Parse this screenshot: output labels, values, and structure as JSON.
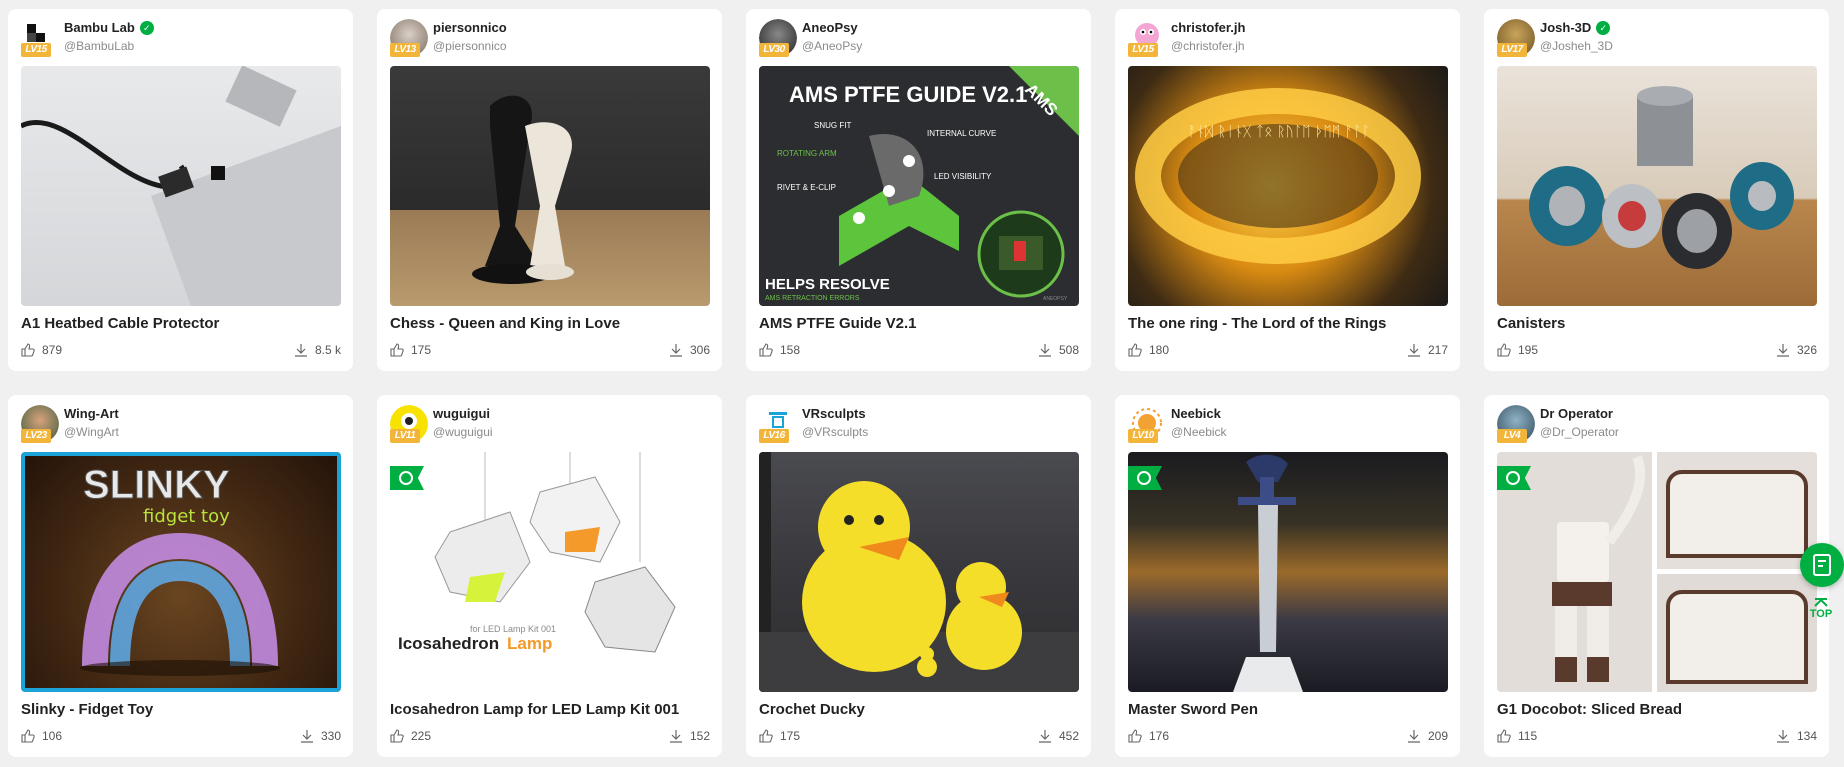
{
  "cards": [
    {
      "user": "Bambu Lab",
      "verified": true,
      "handle": "@BambuLab",
      "level": "LV15",
      "title": "A1 Heatbed Cable Protector",
      "likes": "879",
      "downloads": "8.5 k",
      "badge": false
    },
    {
      "user": "piersonnico",
      "verified": false,
      "handle": "@piersonnico",
      "level": "LV13",
      "title": "Chess - Queen and King in Love",
      "likes": "175",
      "downloads": "306",
      "badge": false
    },
    {
      "user": "AneoPsy",
      "verified": false,
      "handle": "@AneoPsy",
      "level": "LV30",
      "title": "AMS PTFE Guide V2.1",
      "likes": "158",
      "downloads": "508",
      "badge": false
    },
    {
      "user": "christofer.jh",
      "verified": false,
      "handle": "@christofer.jh",
      "level": "LV15",
      "title": "The one ring - The Lord of the Rings",
      "likes": "180",
      "downloads": "217",
      "badge": false
    },
    {
      "user": "Josh-3D",
      "verified": true,
      "handle": "@Josheh_3D",
      "level": "LV17",
      "title": "Canisters",
      "likes": "195",
      "downloads": "326",
      "badge": false
    },
    {
      "user": "Wing-Art",
      "verified": false,
      "handle": "@WingArt",
      "level": "LV23",
      "title": "Slinky - Fidget Toy",
      "likes": "106",
      "downloads": "330",
      "badge": false
    },
    {
      "user": "wuguigui",
      "verified": false,
      "handle": "@wuguigui",
      "level": "LV11",
      "title": "Icosahedron Lamp for LED Lamp Kit 001",
      "likes": "225",
      "downloads": "152",
      "badge": true
    },
    {
      "user": "VRsculpts",
      "verified": false,
      "handle": "@VRsculpts",
      "level": "LV16",
      "title": "Crochet Ducky",
      "likes": "175",
      "downloads": "452",
      "badge": false
    },
    {
      "user": "Neebick",
      "verified": false,
      "handle": "@Neebick",
      "level": "LV10",
      "title": "Master Sword Pen",
      "likes": "176",
      "downloads": "209",
      "badge": true
    },
    {
      "user": "Dr Operator",
      "verified": false,
      "handle": "@Dr_Operator",
      "level": "LV4",
      "title": "G1 Docobot: Sliced Bread",
      "likes": "115",
      "downloads": "134",
      "badge": true
    }
  ],
  "thumb_text": {
    "ams_title": "AMS PTFE GUIDE V2.1",
    "ams_corner": "AMS",
    "ams_labels": [
      "SNUG FIT",
      "INTERNAL CURVE",
      "ROTATING ARM",
      "LED VISIBILITY",
      "RIVET & E-CLIP"
    ],
    "ams_footer": "HELPS RESOLVE",
    "ams_footer_sub": "AMS RETRACTION ERRORS",
    "ams_credit": "ANEOPSY",
    "slinky_title": "SLINKY",
    "slinky_sub": "fidget toy",
    "lamp_caption_small": "for LED Lamp Kit 001",
    "lamp_caption_a": "Icosahedron",
    "lamp_caption_b": "Lamp",
    "ring_text": "ᚨᚾᛞ ᚱᛁᚾᚷ ᛏᛟ ᚱᚢᛚᛖ ᚦᛖᛗ ᚨᛚᛚ"
  },
  "floating": {
    "top_label": "TOP"
  },
  "colors": {
    "accent": "#00ae42",
    "level": "#f2b53a"
  }
}
